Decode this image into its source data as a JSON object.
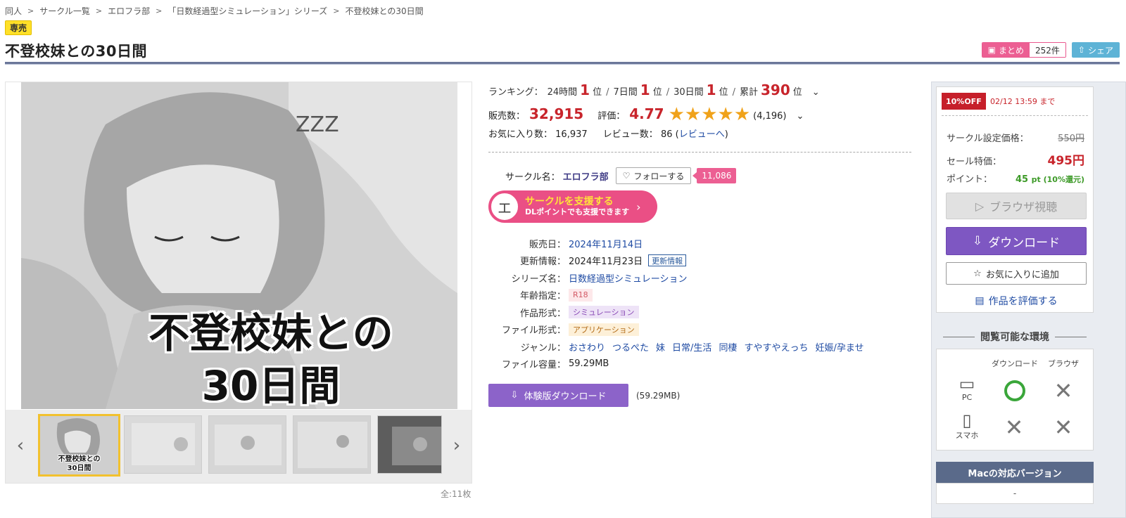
{
  "breadcrumb": [
    "同人",
    "サークル一覧",
    "エロフラ部",
    "「日数経過型シミュレーション」シリーズ",
    "不登校妹との30日間"
  ],
  "badge": "専売",
  "title": "不登校妹との30日間",
  "actions": {
    "matome_label": "まとめ",
    "matome_count": "252件",
    "share_label": "シェア"
  },
  "gallery": {
    "cover_line1": "不登校妹との",
    "cover_line2": "30日間",
    "thumb_label": "不登校妹との\n30日間",
    "prev_icon": "‹",
    "next_icon": "›",
    "count": "全:11枚"
  },
  "ranking": {
    "label": "ランキング：",
    "h24_label": "24時間",
    "h24": "1",
    "unit": "位",
    "d7_label": "7日間",
    "d7": "1",
    "d30_label": "30日間",
    "d30": "1",
    "total_label": "累計",
    "total": "390"
  },
  "sales": {
    "label": "販売数：",
    "value": "32,915",
    "rating_label": "評価：",
    "rating": "4.77",
    "stars": "★★★★★",
    "reviews_count": "(4,196)"
  },
  "favorites": {
    "label": "お気に入り数：",
    "value": "16,937",
    "review_label": "レビュー数：",
    "review_value": "86",
    "review_link": "レビューへ"
  },
  "circle": {
    "label": "サークル名：",
    "name": "エロフラ部",
    "follow_label": "フォローする",
    "follow_count": "11,086"
  },
  "support": {
    "avatar": "エ",
    "title": "サークルを支援する",
    "subtitle": "DLポイントでも支援できます"
  },
  "meta": {
    "release_label": "販売日：",
    "release": "2024年11月14日",
    "update_label": "更新情報：",
    "update": "2024年11月23日",
    "update_tag": "更新情報",
    "series_label": "シリーズ名：",
    "series": "日数経過型シミュレーション",
    "age_label": "年齢指定：",
    "age": "R18",
    "work_label": "作品形式：",
    "work": "シミュレーション",
    "file_label": "ファイル形式：",
    "file": "アプリケーション",
    "genre_label": "ジャンル：",
    "genres": [
      "おさわり",
      "つるぺた",
      "妹",
      "日常/生活",
      "同棲",
      "すやすやえっち",
      "妊娠/孕ませ"
    ],
    "size_label": "ファイル容量：",
    "size": "59.29MB"
  },
  "trial": {
    "label": "体験版ダウンロード",
    "size": "(59.29MB)"
  },
  "price": {
    "off_badge": "10%OFF",
    "off_until": "02/12 13:59 まで",
    "circle_price_label": "サークル設定価格：",
    "circle_price": "550円",
    "sale_label": "セール特価：",
    "sale_price": "495円",
    "point_label": "ポイント：",
    "point_value": "45",
    "point_unit": "pt (10%還元)"
  },
  "buttons": {
    "browser": "ブラウザ視聴",
    "download": "ダウンロード",
    "favorite": "お気に入りに追加",
    "rate": "作品を評価する"
  },
  "env": {
    "title": "閲覧可能な環境",
    "col_download": "ダウンロード",
    "col_browser": "ブラウザ",
    "pc": "PC",
    "smartphone": "スマホ"
  },
  "mac": {
    "title": "Macの対応バージョン",
    "value": "-"
  }
}
